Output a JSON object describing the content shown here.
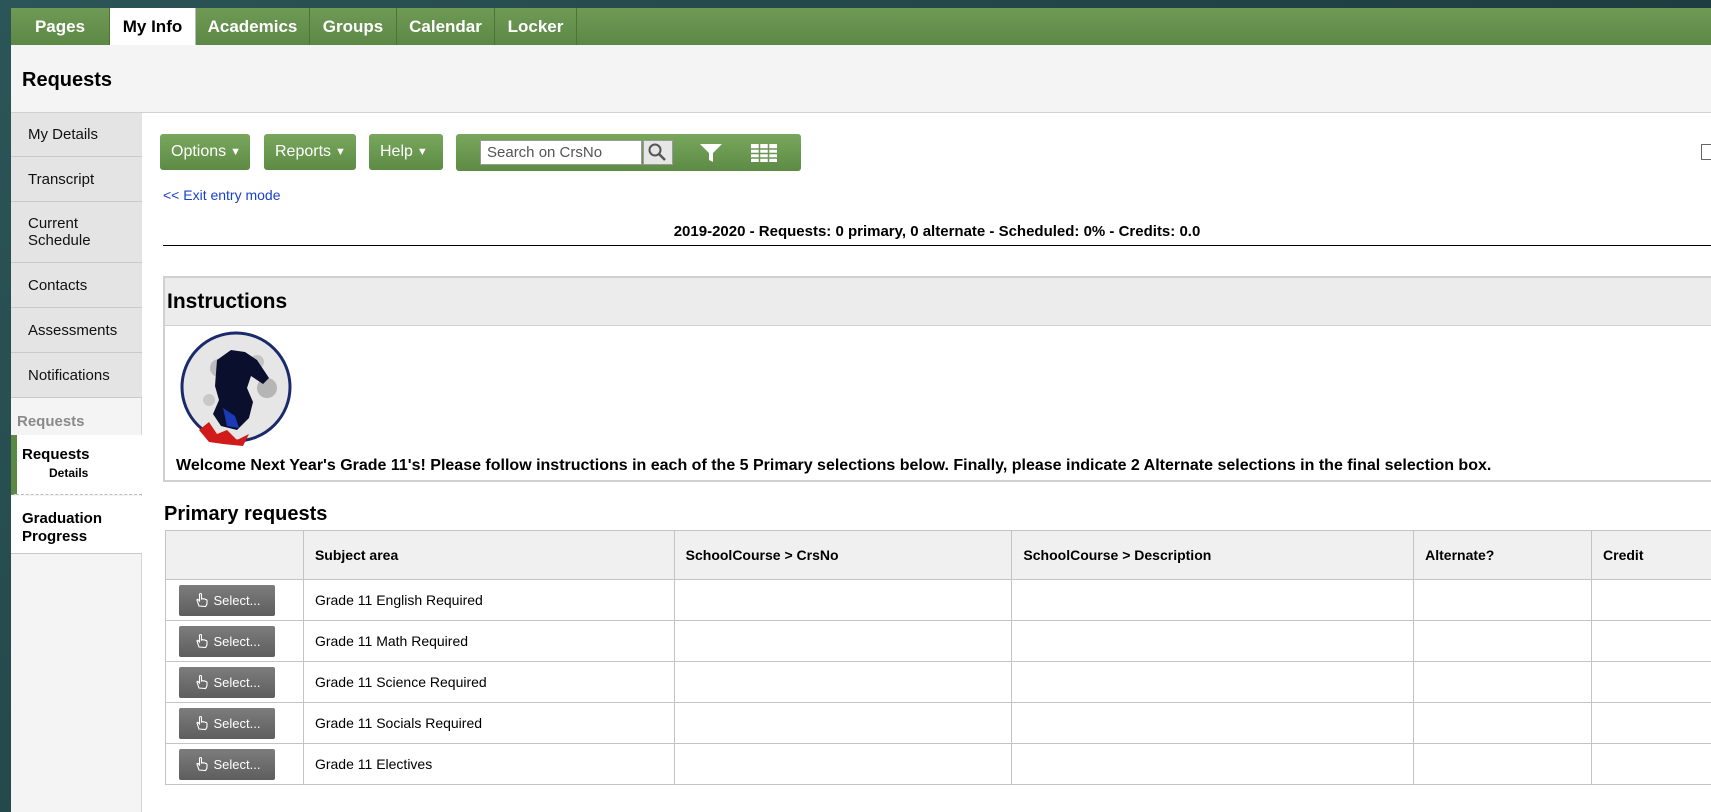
{
  "nav": {
    "tabs": [
      {
        "label": "Pages"
      },
      {
        "label": "My Info"
      },
      {
        "label": "Academics"
      },
      {
        "label": "Groups"
      },
      {
        "label": "Calendar"
      },
      {
        "label": "Locker"
      }
    ],
    "active_tab": "My Info"
  },
  "page": {
    "title": "Requests"
  },
  "sidebar": {
    "items": [
      {
        "label": "My Details"
      },
      {
        "label": "Transcript"
      },
      {
        "label": "Current Schedule"
      },
      {
        "label": "Contacts"
      },
      {
        "label": "Assessments"
      },
      {
        "label": "Notifications"
      }
    ],
    "section_label": "Requests",
    "requests": {
      "label": "Requests",
      "sub_label": "Details"
    },
    "graduation": {
      "label": "Graduation Progress"
    }
  },
  "toolbar": {
    "options_label": "Options",
    "reports_label": "Reports",
    "help_label": "Help",
    "search_placeholder": "Search on CrsNo",
    "exit_link": "<< Exit entry mode"
  },
  "summary": "2019-2020 - Requests: 0 primary, 0 alternate - Scheduled: 0% - Credits: 0.0",
  "instructions": {
    "title": "Instructions",
    "welcome": "Welcome Next Year's Grade 11's! Please follow instructions in each of the 5 Primary selections below.  Finally, please indicate 2 Alternate selections in the final selection box."
  },
  "primary": {
    "title": "Primary requests",
    "columns": [
      "",
      "Subject area",
      "SchoolCourse > CrsNo",
      "SchoolCourse > Description",
      "Alternate?",
      "Credit"
    ],
    "select_label": "Select...",
    "rows": [
      {
        "subject": "Grade 11 English Required",
        "crsno": "",
        "description": "",
        "alternate": "",
        "credit": ""
      },
      {
        "subject": "Grade 11 Math Required",
        "crsno": "",
        "description": "",
        "alternate": "",
        "credit": ""
      },
      {
        "subject": "Grade 11 Science Required",
        "crsno": "",
        "description": "",
        "alternate": "",
        "credit": ""
      },
      {
        "subject": "Grade 11 Socials Required",
        "crsno": "",
        "description": "",
        "alternate": "",
        "credit": ""
      },
      {
        "subject": "Grade 11 Electives",
        "crsno": "",
        "description": "",
        "alternate": "",
        "credit": ""
      }
    ]
  },
  "colors": {
    "accent_green": "#5c8845",
    "link_blue": "#1a3fcf",
    "select_button_gray": "#6b6b6b"
  }
}
